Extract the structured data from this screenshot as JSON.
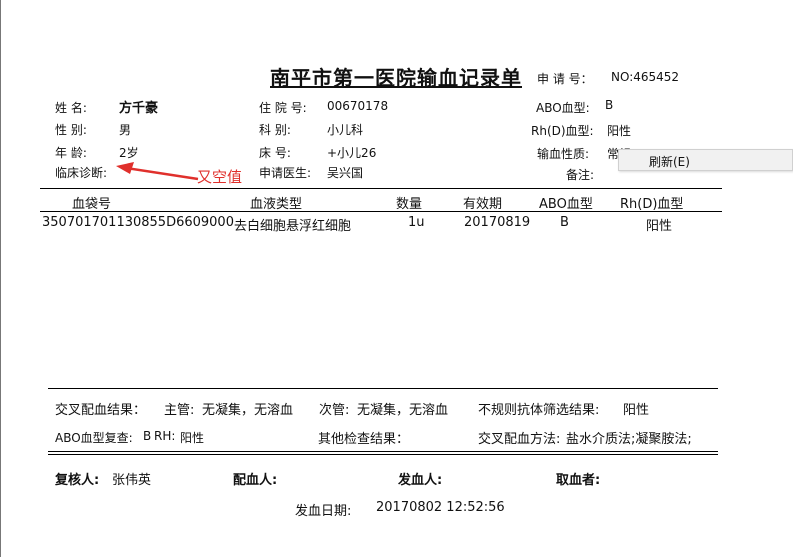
{
  "header": {
    "title": "南平市第一医院输血记录单",
    "request_no_label": "申 请 号：",
    "request_no_value": "NO:465452"
  },
  "patient": {
    "name_label": "姓    名:",
    "name_value": "方千豪",
    "hosp_no_label": "住 院 号:",
    "hosp_no_value": "00670178",
    "abo_label": "ABO血型:",
    "abo_value": "B",
    "sex_label": "性    别:",
    "sex_value": "男",
    "dept_label": "科    别:",
    "dept_value": "小儿科",
    "rh_label": "Rh(D)血型:",
    "rh_value": "阳性",
    "age_label": "年    龄:",
    "age_value": "2岁",
    "bed_label": "床    号:",
    "bed_value": "+小儿26",
    "nature_label": "输血性质:",
    "nature_value": "常规",
    "diag_label": "临床诊断:",
    "doctor_label": "申请医生:",
    "doctor_value": "吴兴国",
    "remark_label": "备注:"
  },
  "annotation": {
    "text": "又空值",
    "color": "#e0302c"
  },
  "table": {
    "headers": [
      "血袋号",
      "血液类型",
      "数量",
      "有效期",
      "ABO血型",
      "Rh(D)血型"
    ],
    "rows": [
      [
        "35070170113085​5D6609000",
        "去白细胞悬浮红细胞",
        "1u",
        "20170819",
        "B",
        "阳性"
      ]
    ]
  },
  "results": {
    "crossmatch_label": "交叉配血结果：",
    "major_label": "主管:",
    "major_value": "无凝集，无溶血",
    "minor_label": "次管:",
    "minor_value": "无凝集，无溶血",
    "antibody_label": "不规则抗体筛选结果:",
    "antibody_value": "阳性",
    "abo_recheck_label": "ABO血型复查:",
    "abo_recheck_value": "B",
    "rh_recheck_label": "RH:",
    "rh_recheck_value": "阳性",
    "other_label": "其他检查结果：",
    "method_label": "交叉配血方法:",
    "method_value": "盐水介质法;凝聚胺法;"
  },
  "signatures": {
    "reviewer_label": "复核人:",
    "reviewer_value": "张伟英",
    "matcher_label": "配血人:",
    "issuer_label": "发血人:",
    "taker_label": "取血者:",
    "issue_date_label": "发血日期:",
    "issue_date_value": "20170802 12:52:56"
  },
  "context_menu": {
    "items": [
      "刷新(E)"
    ]
  }
}
